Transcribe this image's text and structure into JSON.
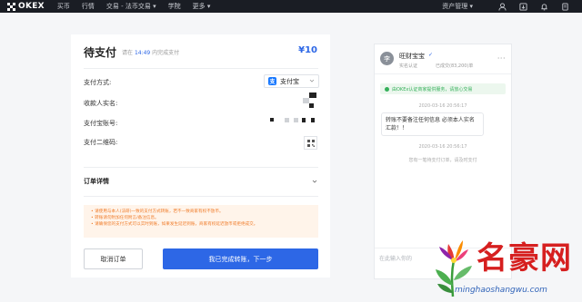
{
  "nav": {
    "logo_text": "OKEX",
    "items": [
      "买币",
      "行情",
      "交易 - 法币交易 ▾",
      "学院",
      "更多 ▾"
    ],
    "asset_label": "资产管理 ▾",
    "icons": [
      "user-icon",
      "download-icon",
      "bell-icon",
      "document-icon"
    ]
  },
  "payment": {
    "title": "待支付",
    "subtitle_prefix": "请在",
    "subtitle_time": "14:49",
    "subtitle_suffix": "内完成支付",
    "amount": "¥10",
    "method_label": "支付方式:",
    "method_value": "支付宝",
    "method_icon_glyph": "支",
    "payee_label": "收款人实名:",
    "account_label": "支付宝账号:",
    "qr_label": "支付二维码:",
    "order_detail_label": "订单详情",
    "notices": [
      "• 请使用与本人(法研)一致的支付方式转账，若不一致商家有权不放币。",
      "• 转账请勿附加任何附言/备注信息。",
      "• 请确保您的支付方式可以实时到账，如果发生延迟到账，商家有权延迟放币或拒绝成交。"
    ],
    "cancel_label": "取消订单",
    "confirm_label": "我已完成转账，下一步"
  },
  "chat": {
    "avatar_text": "李",
    "name": "旺财宝宝",
    "verify_glyph": "✓",
    "stat1": "实名认证",
    "stat2": "已成交(83,200)单",
    "more": "···",
    "system_notice": "由OKEx认证商家提供服务，请放心交易",
    "messages": [
      {
        "time": "2020-03-16 20:56:17",
        "text": "转账不要备注任何信息 必须本人实名汇款！！"
      }
    ],
    "second_time": "2020-03-16 20:56:17",
    "system_message": "您有一笔待支付订单，请及时支付",
    "input_placeholder": "在此输入你的"
  },
  "watermark": {
    "text": "名豪网",
    "url": "minghaoshangwu.com"
  },
  "colors": {
    "accent": "#2d67e6",
    "nav_bg": "#1a1d24",
    "notice_text": "#f07c2a",
    "notice_bg": "#fff4ea",
    "success": "#35b05a",
    "watermark_red": "#d61f1f"
  }
}
